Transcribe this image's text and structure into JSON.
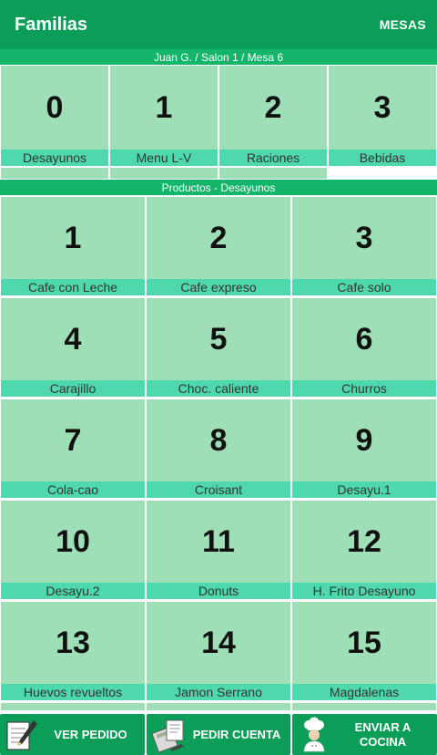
{
  "header": {
    "title": "Familias",
    "mesas_label": "MESAS"
  },
  "info_bar": "Juan G. / Salon 1 / Mesa 6",
  "families": [
    {
      "num": "0",
      "label": "Desayunos"
    },
    {
      "num": "1",
      "label": "Menu L-V"
    },
    {
      "num": "2",
      "label": "Raciones"
    },
    {
      "num": "3",
      "label": "Bebidas"
    }
  ],
  "products_bar": "Productos - Desayunos",
  "products": [
    {
      "num": "1",
      "label": "Cafe con Leche"
    },
    {
      "num": "2",
      "label": "Cafe expreso"
    },
    {
      "num": "3",
      "label": "Cafe solo"
    },
    {
      "num": "4",
      "label": "Carajillo"
    },
    {
      "num": "5",
      "label": "Choc. caliente"
    },
    {
      "num": "6",
      "label": "Churros"
    },
    {
      "num": "7",
      "label": "Cola-cao"
    },
    {
      "num": "8",
      "label": "Croisant"
    },
    {
      "num": "9",
      "label": "Desayu.1"
    },
    {
      "num": "10",
      "label": "Desayu.2"
    },
    {
      "num": "11",
      "label": "Donuts"
    },
    {
      "num": "12",
      "label": "H. Frito Desayuno"
    },
    {
      "num": "13",
      "label": "Huevos revueltos"
    },
    {
      "num": "14",
      "label": "Jamon Serrano"
    },
    {
      "num": "15",
      "label": "Magdalenas"
    }
  ],
  "buttons": {
    "ver_pedido": "VER PEDIDO",
    "pedir_cuenta": "PEDIR CUENTA",
    "enviar_line1": "ENVIAR A",
    "enviar_line2": "COCINA"
  },
  "icons": {
    "ver_pedido": "notepad-pencil-icon",
    "pedir_cuenta": "bill-calculator-icon",
    "enviar_cocina": "chef-icon"
  },
  "colors": {
    "primary": "#0c9e58",
    "strip": "#13b56a",
    "tile": "#9fdfb8",
    "tile_label": "#4fd8ae"
  }
}
